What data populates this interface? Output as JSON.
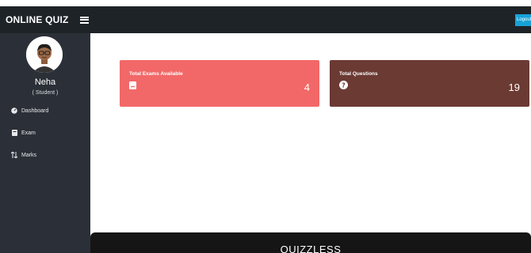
{
  "header": {
    "title": "ONLINE QUIZ",
    "logout_label": "Logout"
  },
  "sidebar": {
    "user_name": "Neha",
    "user_role": "( Student )",
    "items": [
      {
        "label": "Dashboard",
        "icon": "dashboard-icon"
      },
      {
        "label": "Exam",
        "icon": "book-icon"
      },
      {
        "label": "Marks",
        "icon": "sort-icon"
      }
    ]
  },
  "cards": [
    {
      "title": "Total Exams Available",
      "value": "4",
      "icon": "exam-icon",
      "color": "#f26868"
    },
    {
      "title": "Total Questions",
      "value": "19",
      "icon": "question-circle-icon",
      "color": "#6b3a33"
    }
  ],
  "footer": {
    "text": "QUIZZLESS"
  },
  "colors": {
    "topbar": "#1e2328",
    "sidebar": "#2b3038",
    "accent": "#17a2d6"
  }
}
